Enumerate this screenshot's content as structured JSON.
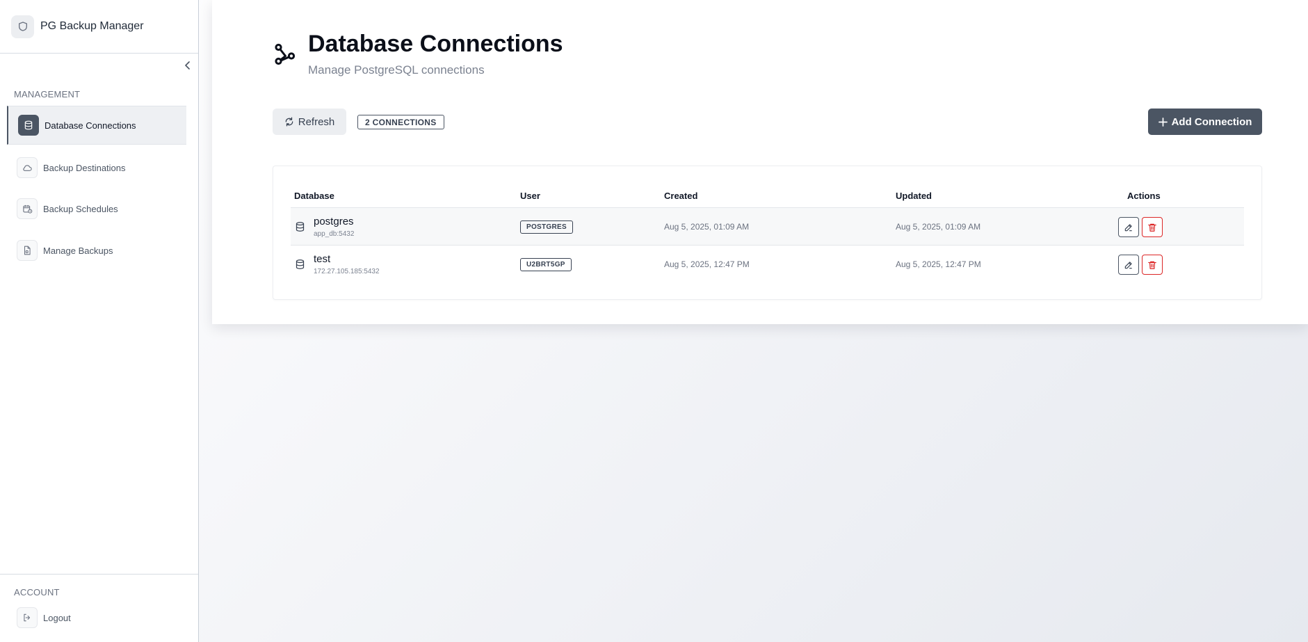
{
  "app": {
    "name": "PG Backup Manager"
  },
  "sidebar": {
    "management_label": "MANAGEMENT",
    "items": [
      {
        "label": "Database Connections",
        "icon": "database-icon",
        "active": true
      },
      {
        "label": "Backup Destinations",
        "icon": "cloud-icon",
        "active": false
      },
      {
        "label": "Backup Schedules",
        "icon": "calendar-clock-icon",
        "active": false
      },
      {
        "label": "Manage Backups",
        "icon": "file-archive-icon",
        "active": false
      }
    ],
    "account_label": "ACCOUNT",
    "logout_label": "Logout"
  },
  "page": {
    "title": "Database Connections",
    "subtitle": "Manage PostgreSQL connections"
  },
  "toolbar": {
    "refresh_label": "Refresh",
    "count_badge": "2 CONNECTIONS",
    "add_label": "Add Connection"
  },
  "table": {
    "columns": [
      "Database",
      "User",
      "Created",
      "Updated",
      "Actions"
    ],
    "rows": [
      {
        "name": "postgres",
        "host": "app_db:5432",
        "user": "POSTGRES",
        "created": "Aug 5, 2025, 01:09 AM",
        "updated": "Aug 5, 2025, 01:09 AM"
      },
      {
        "name": "test",
        "host": "172.27.105.185:5432",
        "user": "U2BRT5GP",
        "created": "Aug 5, 2025, 12:47 PM",
        "updated": "Aug 5, 2025, 12:47 PM"
      }
    ]
  },
  "colors": {
    "accent": "#4b5563",
    "danger": "#dc2626",
    "sidebar_bg": "#ffffff",
    "active_bg": "#eef0f3"
  }
}
